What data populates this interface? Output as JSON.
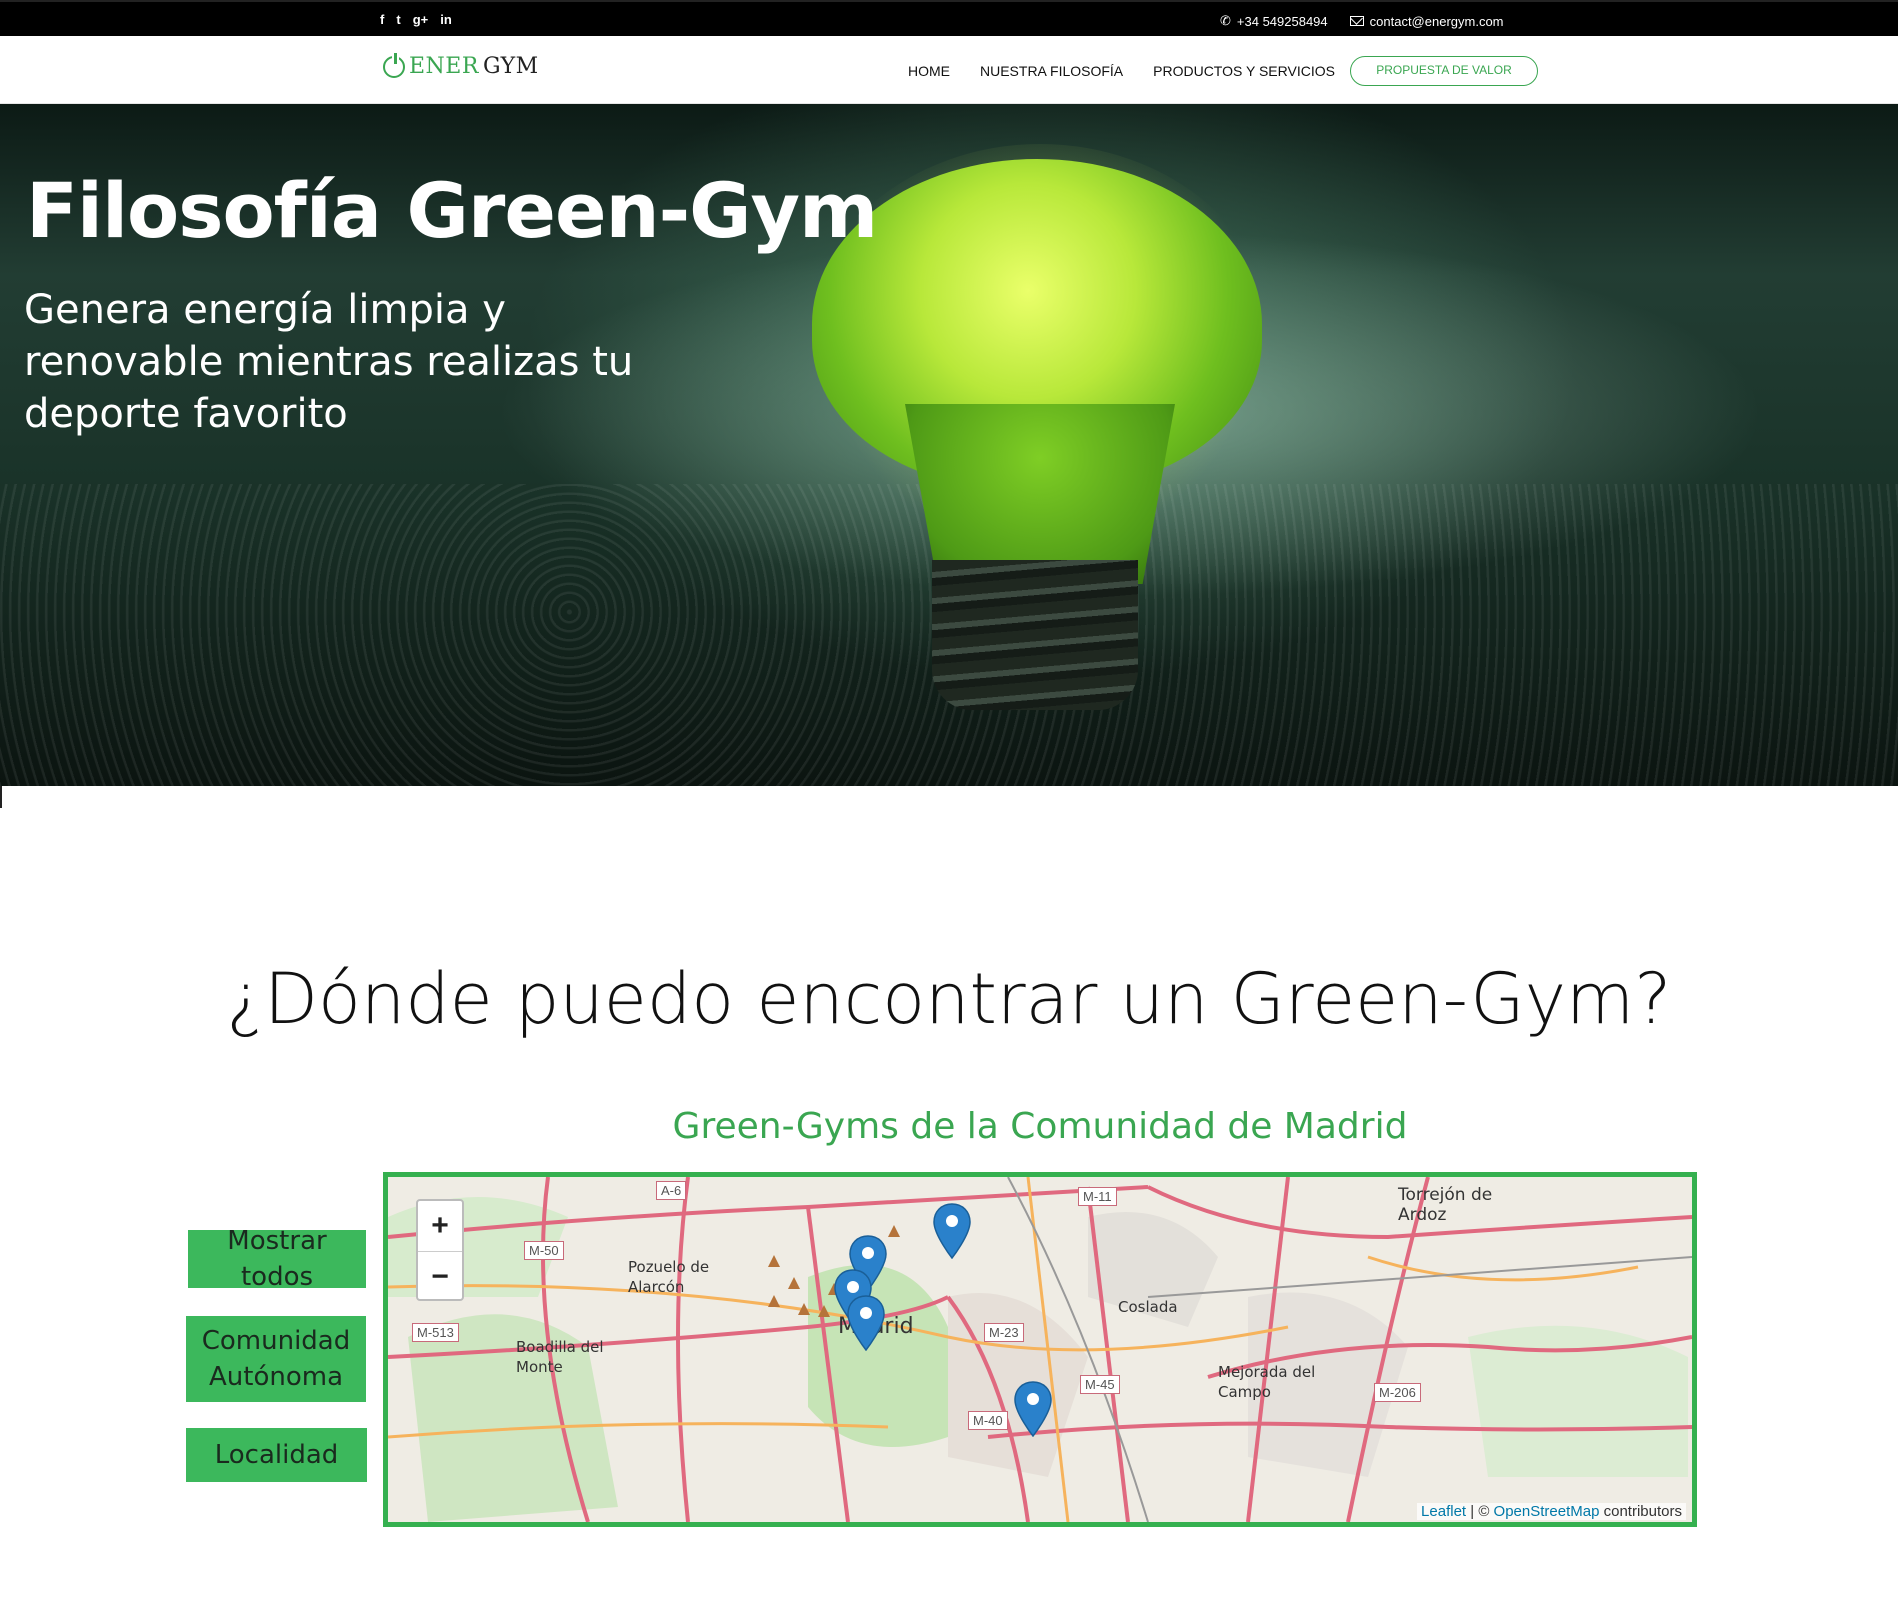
{
  "topbar": {
    "social": [
      "f",
      "t",
      "g+",
      "in"
    ],
    "phone": "+34 549258494",
    "email": "contact@energym.com"
  },
  "nav": {
    "logo_ener": "ENER",
    "logo_gym": "GYM",
    "items": [
      "HOME",
      "NUESTRA FILOSOFÍA",
      "PRODUCTOS Y SERVICIOS"
    ],
    "cta": "PROPUESTA DE VALOR"
  },
  "hero": {
    "title": "Filosofía Green-Gym",
    "subtitle": "Genera energía limpia y renovable mientras realizas tu deporte favorito"
  },
  "finder": {
    "title": "¿Dónde puedo encontrar un Green-Gym?",
    "map_title": "Green-Gyms de la Comunidad de Madrid",
    "buttons": {
      "all": "Mostrar todos",
      "region": "Comunidad Autónoma",
      "city": "Localidad"
    }
  },
  "map": {
    "zoom_in": "+",
    "zoom_out": "−",
    "attribution_leaflet": "Leaflet",
    "attribution_sep": " | © ",
    "attribution_osm": "OpenStreetMap",
    "attribution_tail": " contributors",
    "places": {
      "torrejon": "Torrejón de Ardoz",
      "pozuelo": "Pozuelo de Alarcón",
      "boadilla": "Boadilla del Monte",
      "madrid": "Madrid",
      "coslada": "Coslada",
      "mejorada": "Mejorada del Campo"
    },
    "roads": [
      "A-6",
      "M-11",
      "M-50",
      "M-513",
      "M-23",
      "M-45",
      "M-40",
      "M-206"
    ],
    "marker_color": "#2a81cb"
  }
}
